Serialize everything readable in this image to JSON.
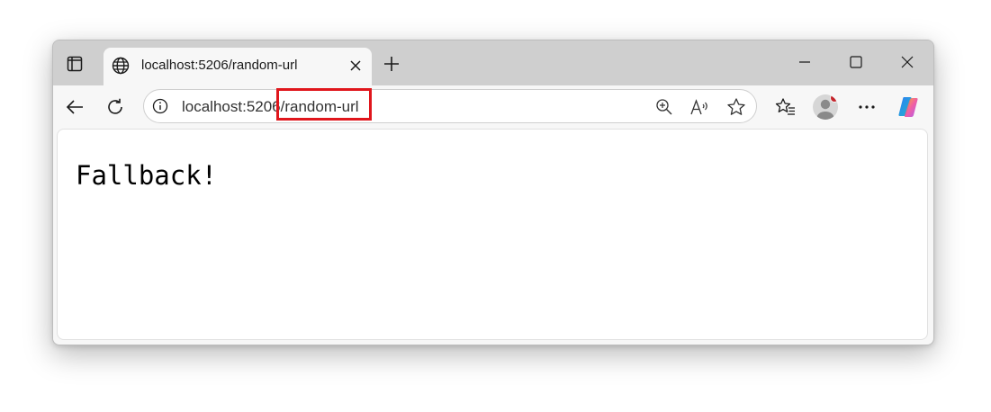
{
  "tab": {
    "title": "localhost:5206/random-url",
    "favicon": "globe-icon",
    "close_icon": "close-icon"
  },
  "tabstrip": {
    "actions_icon": "tab-actions-icon",
    "new_tab_icon": "plus-icon"
  },
  "window_controls": {
    "minimize_icon": "minimize-icon",
    "maximize_icon": "maximize-icon",
    "close_icon": "close-icon"
  },
  "toolbar": {
    "back_icon": "back-arrow-icon",
    "refresh_icon": "refresh-icon",
    "favorites_icon": "favorites-icon",
    "profile_icon": "avatar",
    "more_icon": "more-icon",
    "copilot_icon": "copilot-icon"
  },
  "address_bar": {
    "url": "localhost:5206/random-url",
    "info_icon": "info-icon",
    "zoom_icon": "zoom-icon",
    "read_aloud_icon": "read-aloud-icon",
    "favorite_icon": "star-icon",
    "highlight_color": "#e0161c"
  },
  "page": {
    "text": "Fallback!"
  },
  "colors": {
    "frame": "#cfcfcf",
    "toolbar": "#f7f7f7",
    "notification_dot": "#c4242b"
  }
}
